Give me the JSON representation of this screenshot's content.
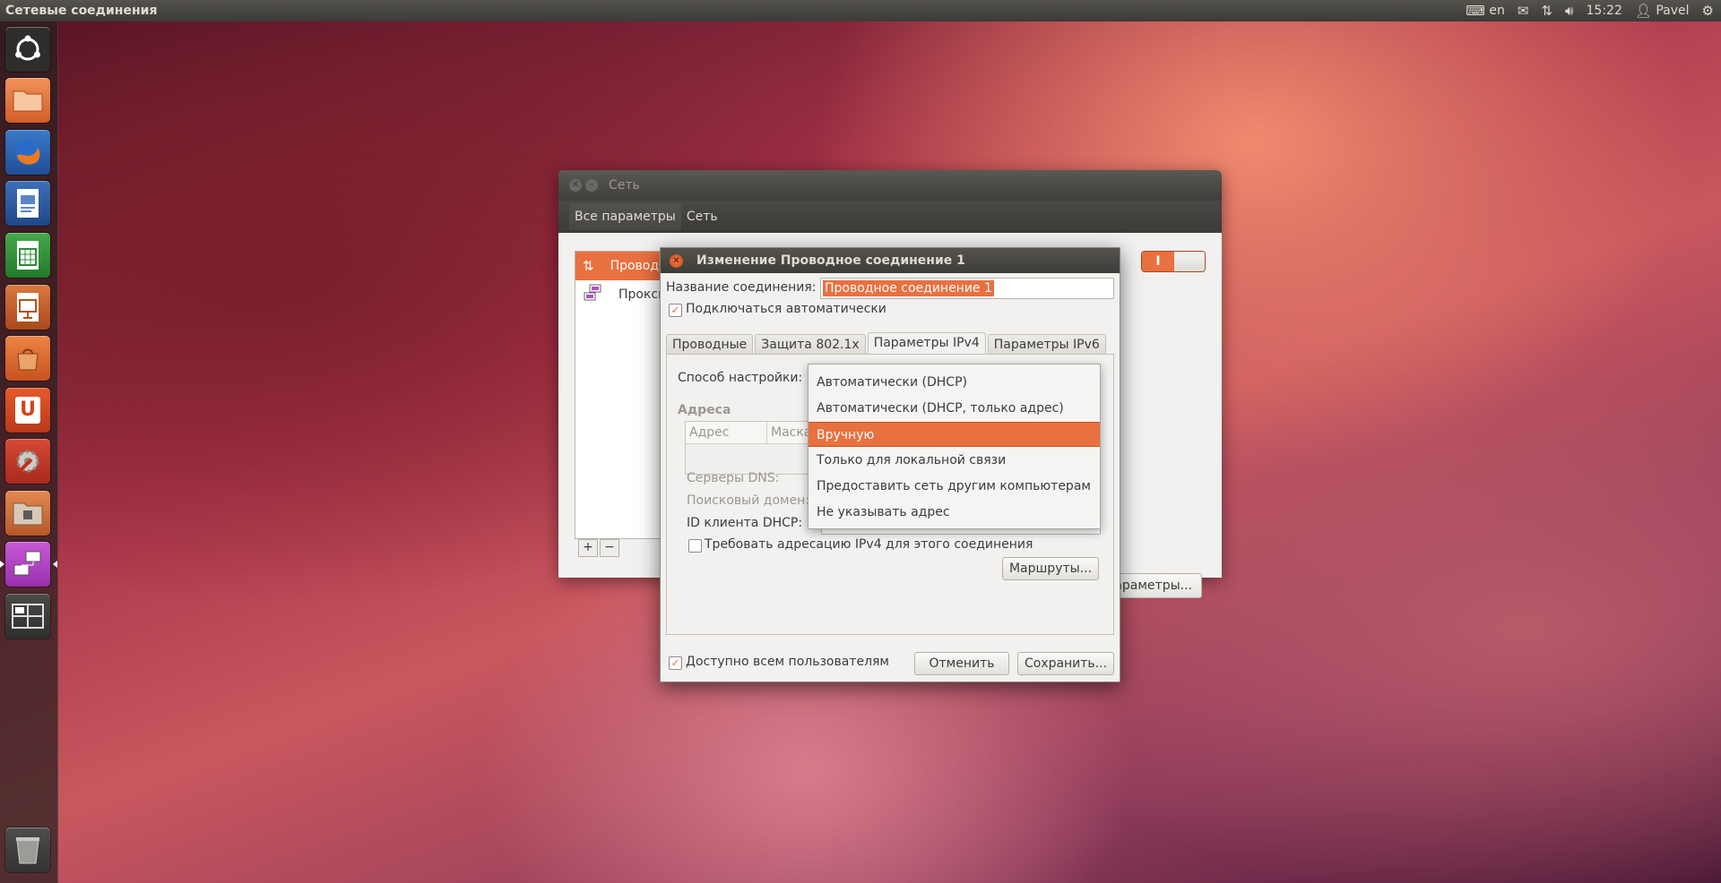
{
  "top_panel": {
    "title": "Сетевые соединения",
    "keyboard_layout": "en",
    "time": "15:22",
    "user": "Pavel"
  },
  "launcher": {
    "items": [
      {
        "name": "ubuntu-dash",
        "color": "#3a3a3a"
      },
      {
        "name": "files",
        "color": "#e0703c"
      },
      {
        "name": "firefox",
        "color": "#2f5fa6"
      },
      {
        "name": "writer",
        "color": "#2a5aa0"
      },
      {
        "name": "calc",
        "color": "#2d8f34"
      },
      {
        "name": "impress",
        "color": "#c05a2a"
      },
      {
        "name": "software-center",
        "color": "#d8622c"
      },
      {
        "name": "ubuntu-one",
        "color": "#d24a1c"
      },
      {
        "name": "system-settings",
        "color": "#c43a2a"
      },
      {
        "name": "backup",
        "color": "#c9622e"
      },
      {
        "name": "network-connections",
        "color": "#b844c8"
      },
      {
        "name": "workspace-switcher",
        "color": "#3a3a3a"
      },
      {
        "name": "trash",
        "color": "#4a4a4a"
      }
    ],
    "ubuntu_one_letter": "U"
  },
  "network_window": {
    "title": "Сеть",
    "breadcrumbs": [
      "Все параметры",
      "Сеть"
    ],
    "connections": [
      {
        "label": "Проводное соединение",
        "icon": "wired-arrows-icon"
      },
      {
        "label": "Прокси-сервер",
        "icon": "proxy-icon"
      }
    ],
    "toggle_label": "I",
    "params_button": "Параметры..."
  },
  "edit_dialog": {
    "title": "Изменение Проводное соединение 1",
    "connection_name_label": "Название соединения:",
    "connection_name_value": "Проводное соединение 1",
    "auto_connect_label": "Подключаться автоматически",
    "tabs": [
      "Проводные",
      "Защита 802.1x",
      "Параметры IPv4",
      "Параметры IPv6"
    ],
    "active_tab": "Параметры IPv4",
    "method_label": "Способ настройки:",
    "addresses_label": "Адреса",
    "address_columns": [
      "Адрес",
      "Маска"
    ],
    "dns_label": "Серверы DNS:",
    "search_domain_label": "Поисковый домен:",
    "dhcp_client_id_label": "ID клиента DHCP:",
    "require_ipv4_label": "Требовать адресацию IPv4 для этого соединения",
    "routes_button": "Маршруты...",
    "available_all_users_label": "Доступно всем пользователям",
    "cancel_button": "Отменить",
    "save_button": "Сохранить..."
  },
  "method_dropdown": {
    "options": [
      "Автоматически (DHCP)",
      "Автоматически (DHCP, только адрес)",
      "Вручную",
      "Только для локальной связи",
      "Предоставить сеть другим компьютерам",
      "Не указывать адрес"
    ],
    "selected": "Вручную"
  },
  "colors": {
    "accent": "#e9703f",
    "panel": "#3c3b37"
  }
}
